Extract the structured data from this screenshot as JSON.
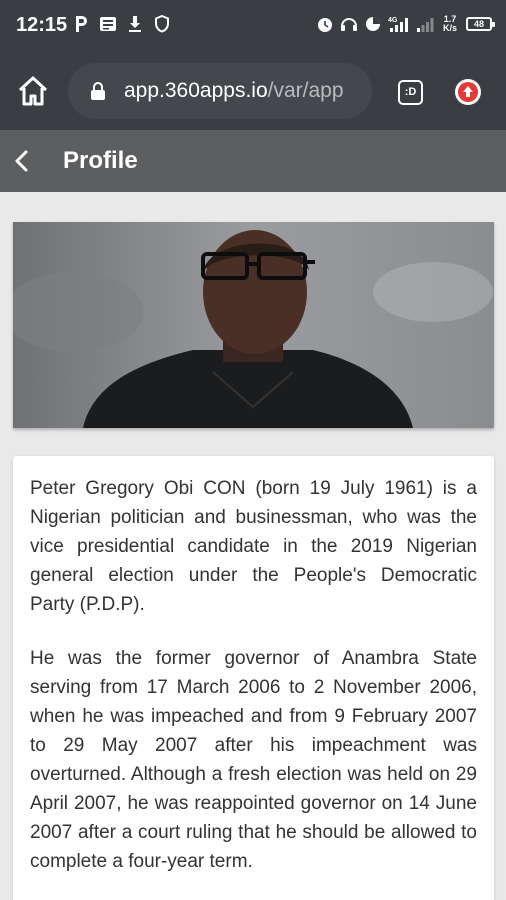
{
  "status_bar": {
    "time": "12:15",
    "net_speed": "1.7 K/s",
    "network": "4G",
    "battery": "48",
    "icons_left": [
      "p-icon",
      "message-icon",
      "download-icon",
      "shield-icon"
    ],
    "icons_right": [
      "alarm-icon",
      "headset-icon",
      "data-saver-icon",
      "signal-icon",
      "signal-icon",
      "battery-icon"
    ]
  },
  "browser": {
    "url_host": "app.360apps.io",
    "url_path": "/var/app",
    "tabs_label": ":D"
  },
  "header": {
    "title": "Profile"
  },
  "profile": {
    "paragraphs": [
      "Peter Gregory Obi CON (born 19 July 1961) is a Nigerian politician and businessman, who was the vice presidential candidate in the 2019 Nigerian general election under the People's Democratic Party (P.D.P).",
      "He was the former governor of Anambra State serving from 17 March 2006 to 2 November 2006, when he was impeached and from 9 February 2007 to 29 May 2007 after his impeachment was overturned. Although a fresh election was held on 29 April 2007, he was reappointed governor on 14 June 2007 after a court ruling that he should be allowed to complete a four-year term."
    ]
  },
  "colors": {
    "chrome": "#3a3d41",
    "app_header": "#5d5e60",
    "page_bg": "#e9e9e9",
    "update_accent": "#e53935"
  }
}
